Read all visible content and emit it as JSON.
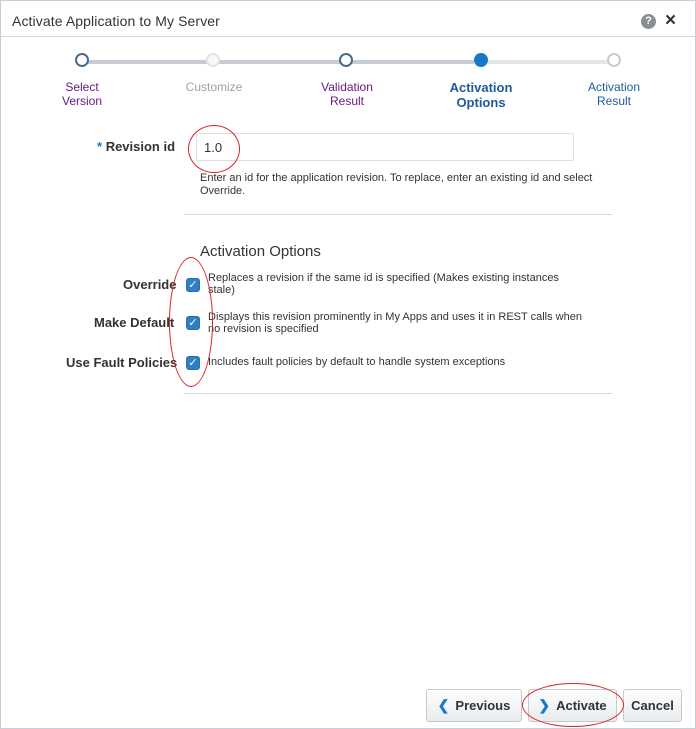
{
  "window": {
    "title": "Activate Application to My Server",
    "help_glyph": "?",
    "close_glyph": "×"
  },
  "train": {
    "steps": [
      {
        "label_line1": "Select",
        "label_line2": "Version",
        "state": "visited"
      },
      {
        "label_line1": "Customize",
        "label_line2": "",
        "state": "disabled"
      },
      {
        "label_line1": "Validation",
        "label_line2": "Result",
        "state": "visited"
      },
      {
        "label_line1": "Activation",
        "label_line2": "Options",
        "state": "current"
      },
      {
        "label_line1": "Activation",
        "label_line2": "Result",
        "state": "unvisited"
      }
    ]
  },
  "form": {
    "required_marker": "*",
    "revision_label": "Revision id",
    "revision_value": "1.0",
    "revision_help": "Enter an id for the application revision. To replace, enter an existing id and select Override.",
    "section_title": "Activation Options",
    "options": [
      {
        "label": "Override",
        "checked": true,
        "desc": "Replaces a revision if the same id is specified (Makes existing instances stale)"
      },
      {
        "label": "Make Default",
        "checked": true,
        "desc": "Displays this revision prominently in My Apps and uses it in REST calls when no revision is specified"
      },
      {
        "label": "Use Fault Policies",
        "checked": true,
        "desc": "Includes fault policies by default to handle system exceptions"
      }
    ]
  },
  "footer": {
    "previous_label": "Previous",
    "activate_label": "Activate",
    "cancel_label": "Cancel",
    "previous_glyph": "❮",
    "activate_glyph": "❯"
  },
  "colors": {
    "accent": "#1a78c9",
    "visited_step": "#6b1980",
    "annotation": "#d8232a"
  }
}
